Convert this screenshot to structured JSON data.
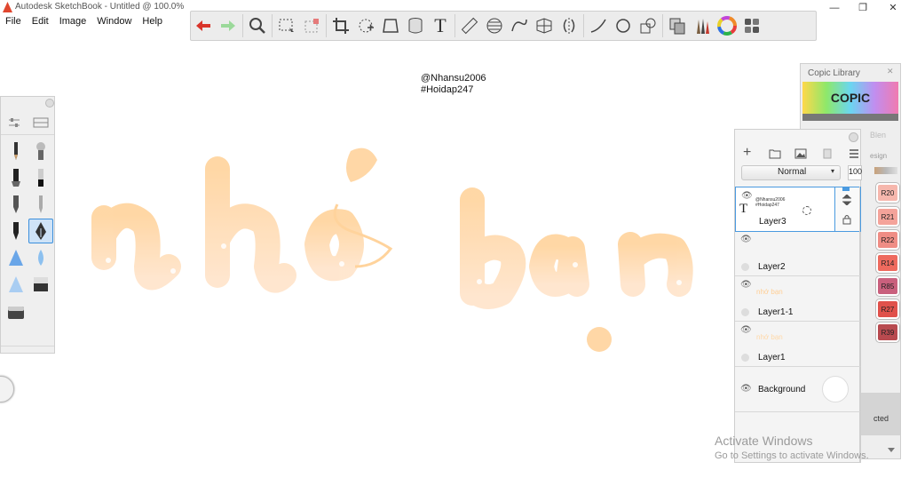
{
  "window": {
    "title": "Autodesk SketchBook - Untitled @ 100.0%",
    "minimize_label": "—",
    "restore_label": "❐",
    "close_label": "✕"
  },
  "menu": [
    "File",
    "Edit",
    "Image",
    "Window",
    "Help"
  ],
  "toolbar": {
    "icons": [
      "undo-icon",
      "redo-icon",
      "zoom-icon",
      "select-rect-icon",
      "select-remove-icon",
      "crop-icon",
      "lasso-icon",
      "transform-icon",
      "cylinder-icon",
      "text-icon",
      "ruler-icon",
      "ellipse-guide-icon",
      "curve-guide-icon",
      "perspective-icon",
      "symmetry-icon",
      "stroke-icon",
      "circle-icon",
      "shape-icon",
      "copy-icon",
      "brush-library-icon",
      "color-wheel-icon",
      "layout-icon"
    ],
    "text_tool_label": "T"
  },
  "canvas": {
    "line1": "@Nhansu2006",
    "line2": "#Hoidap247",
    "lettering_text": "nhớ bạn",
    "lettering_color": "#ffd39c"
  },
  "copic": {
    "title": "Copic Library",
    "logo": "COPIC",
    "close_label": "✕",
    "label_blend": "Blen",
    "label_design": "esign",
    "footer": "cted",
    "swatches": [
      {
        "code": "R20",
        "color": "#f6b7ad"
      },
      {
        "code": "R21",
        "color": "#f4a39a"
      },
      {
        "code": "R22",
        "color": "#ef8d85"
      },
      {
        "code": "R14",
        "color": "#ee6a5e"
      },
      {
        "code": "R85",
        "color": "#c9607d"
      },
      {
        "code": "R27",
        "color": "#e0514b"
      },
      {
        "code": "R39",
        "color": "#b84a4f"
      }
    ]
  },
  "layers": {
    "blend_mode": "Normal",
    "opacity": "100",
    "items": [
      {
        "name": "Layer3",
        "thumb_text": "@Nhansu2006\n#Hoidap247"
      },
      {
        "name": "Layer2"
      },
      {
        "name": "Layer1-1"
      },
      {
        "name": "Layer1"
      },
      {
        "name": "Background"
      }
    ],
    "thumb_letters": "nhớ bạn"
  },
  "watermark": {
    "line1": "Activate Windows",
    "line2": "Go to Settings to activate Windows."
  }
}
